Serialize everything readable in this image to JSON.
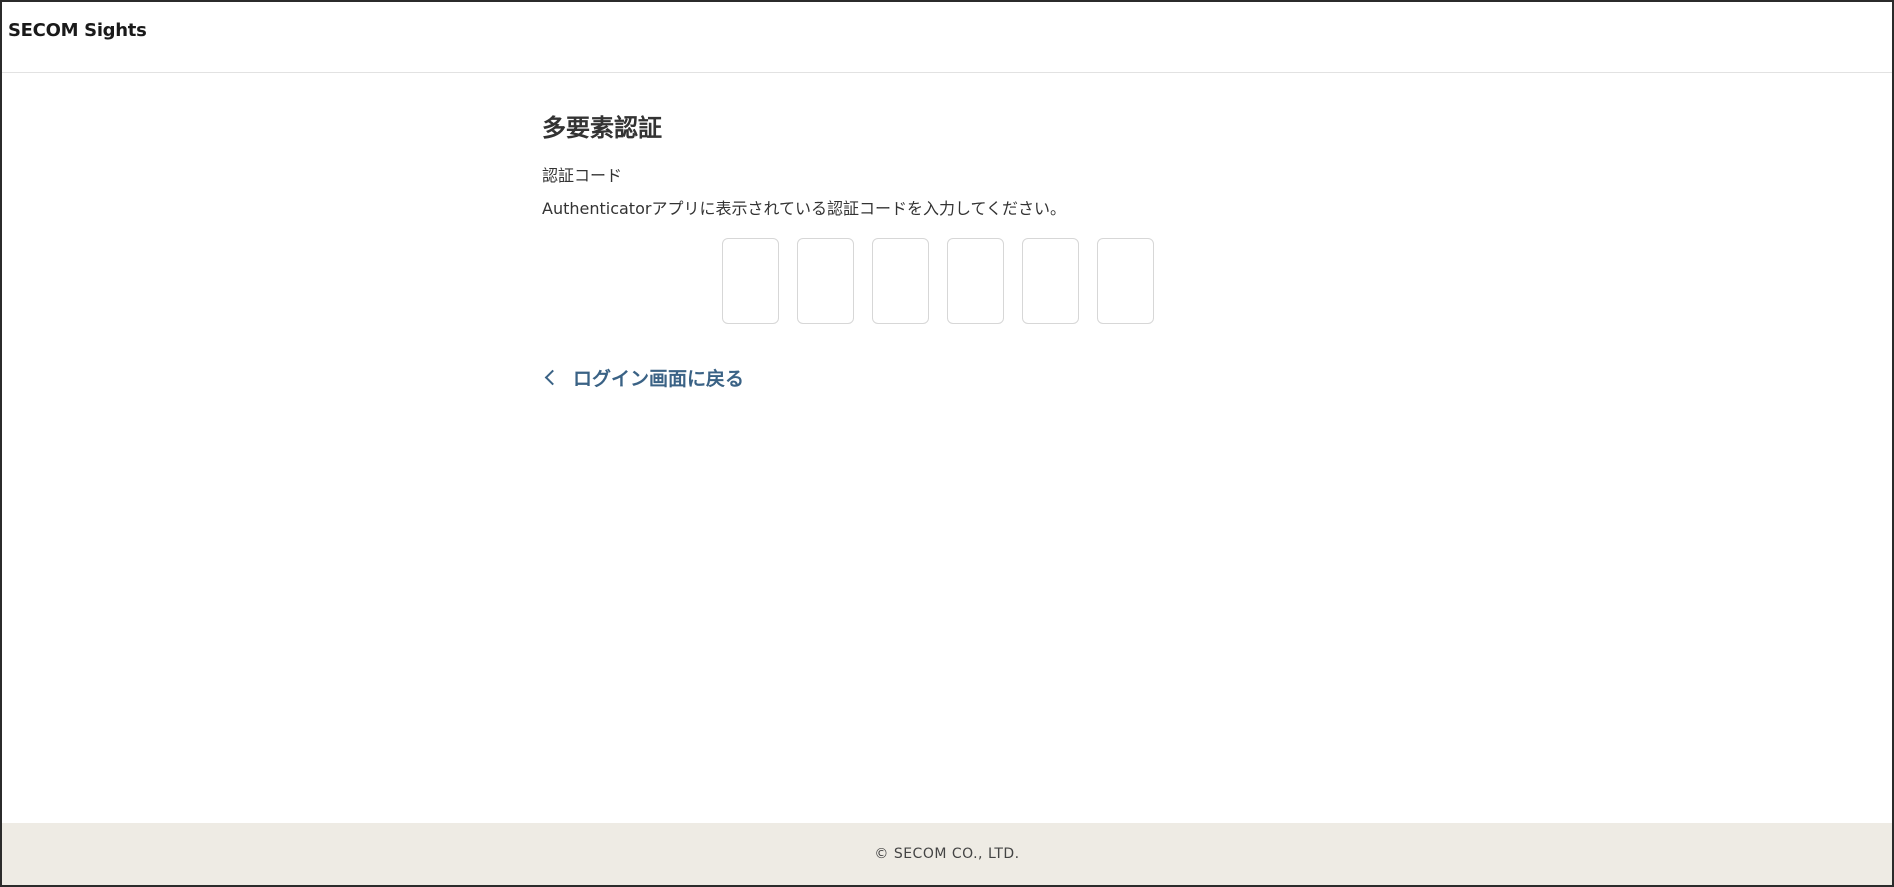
{
  "header": {
    "logo_text": "SECOM Sights"
  },
  "main": {
    "title": "多要素認証",
    "field_label": "認証コード",
    "description": "Authenticatorアプリに表示されている認証コードを入力してください。",
    "code_inputs": [
      {
        "value": ""
      },
      {
        "value": ""
      },
      {
        "value": ""
      },
      {
        "value": ""
      },
      {
        "value": ""
      },
      {
        "value": ""
      }
    ],
    "back_link_label": "ログイン画面に戻る",
    "back_icon": "chevron-left-icon"
  },
  "footer": {
    "copyright": "© SECOM CO., LTD."
  },
  "colors": {
    "link": "#3a6285",
    "footer_bg": "#eeebe4",
    "input_border": "#d7d7d7"
  }
}
